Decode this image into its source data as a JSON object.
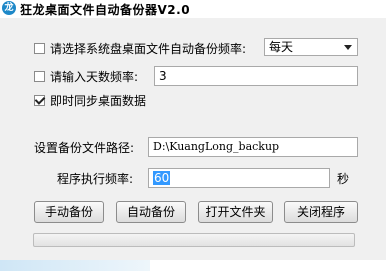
{
  "window": {
    "title": "狂龙桌面文件自动备份器V2.0"
  },
  "options": {
    "auto_backup_label": "请选择系统盘桌面文件自动备份频率:",
    "frequency_select_value": "每天",
    "days_label": "请输入天数频率:",
    "days_value": "3",
    "sync_label": "即时同步桌面数据"
  },
  "settings": {
    "path_label": "设置备份文件路径:",
    "path_value": "D:\\KuangLong_backup",
    "interval_label": "程序执行频率:",
    "interval_value": "60",
    "interval_unit": "秒"
  },
  "buttons": {
    "manual": "手动备份",
    "auto": "自动备份",
    "open_folder": "打开文件夹",
    "close": "关闭程序"
  },
  "progress": {
    "value_percent": 0
  }
}
